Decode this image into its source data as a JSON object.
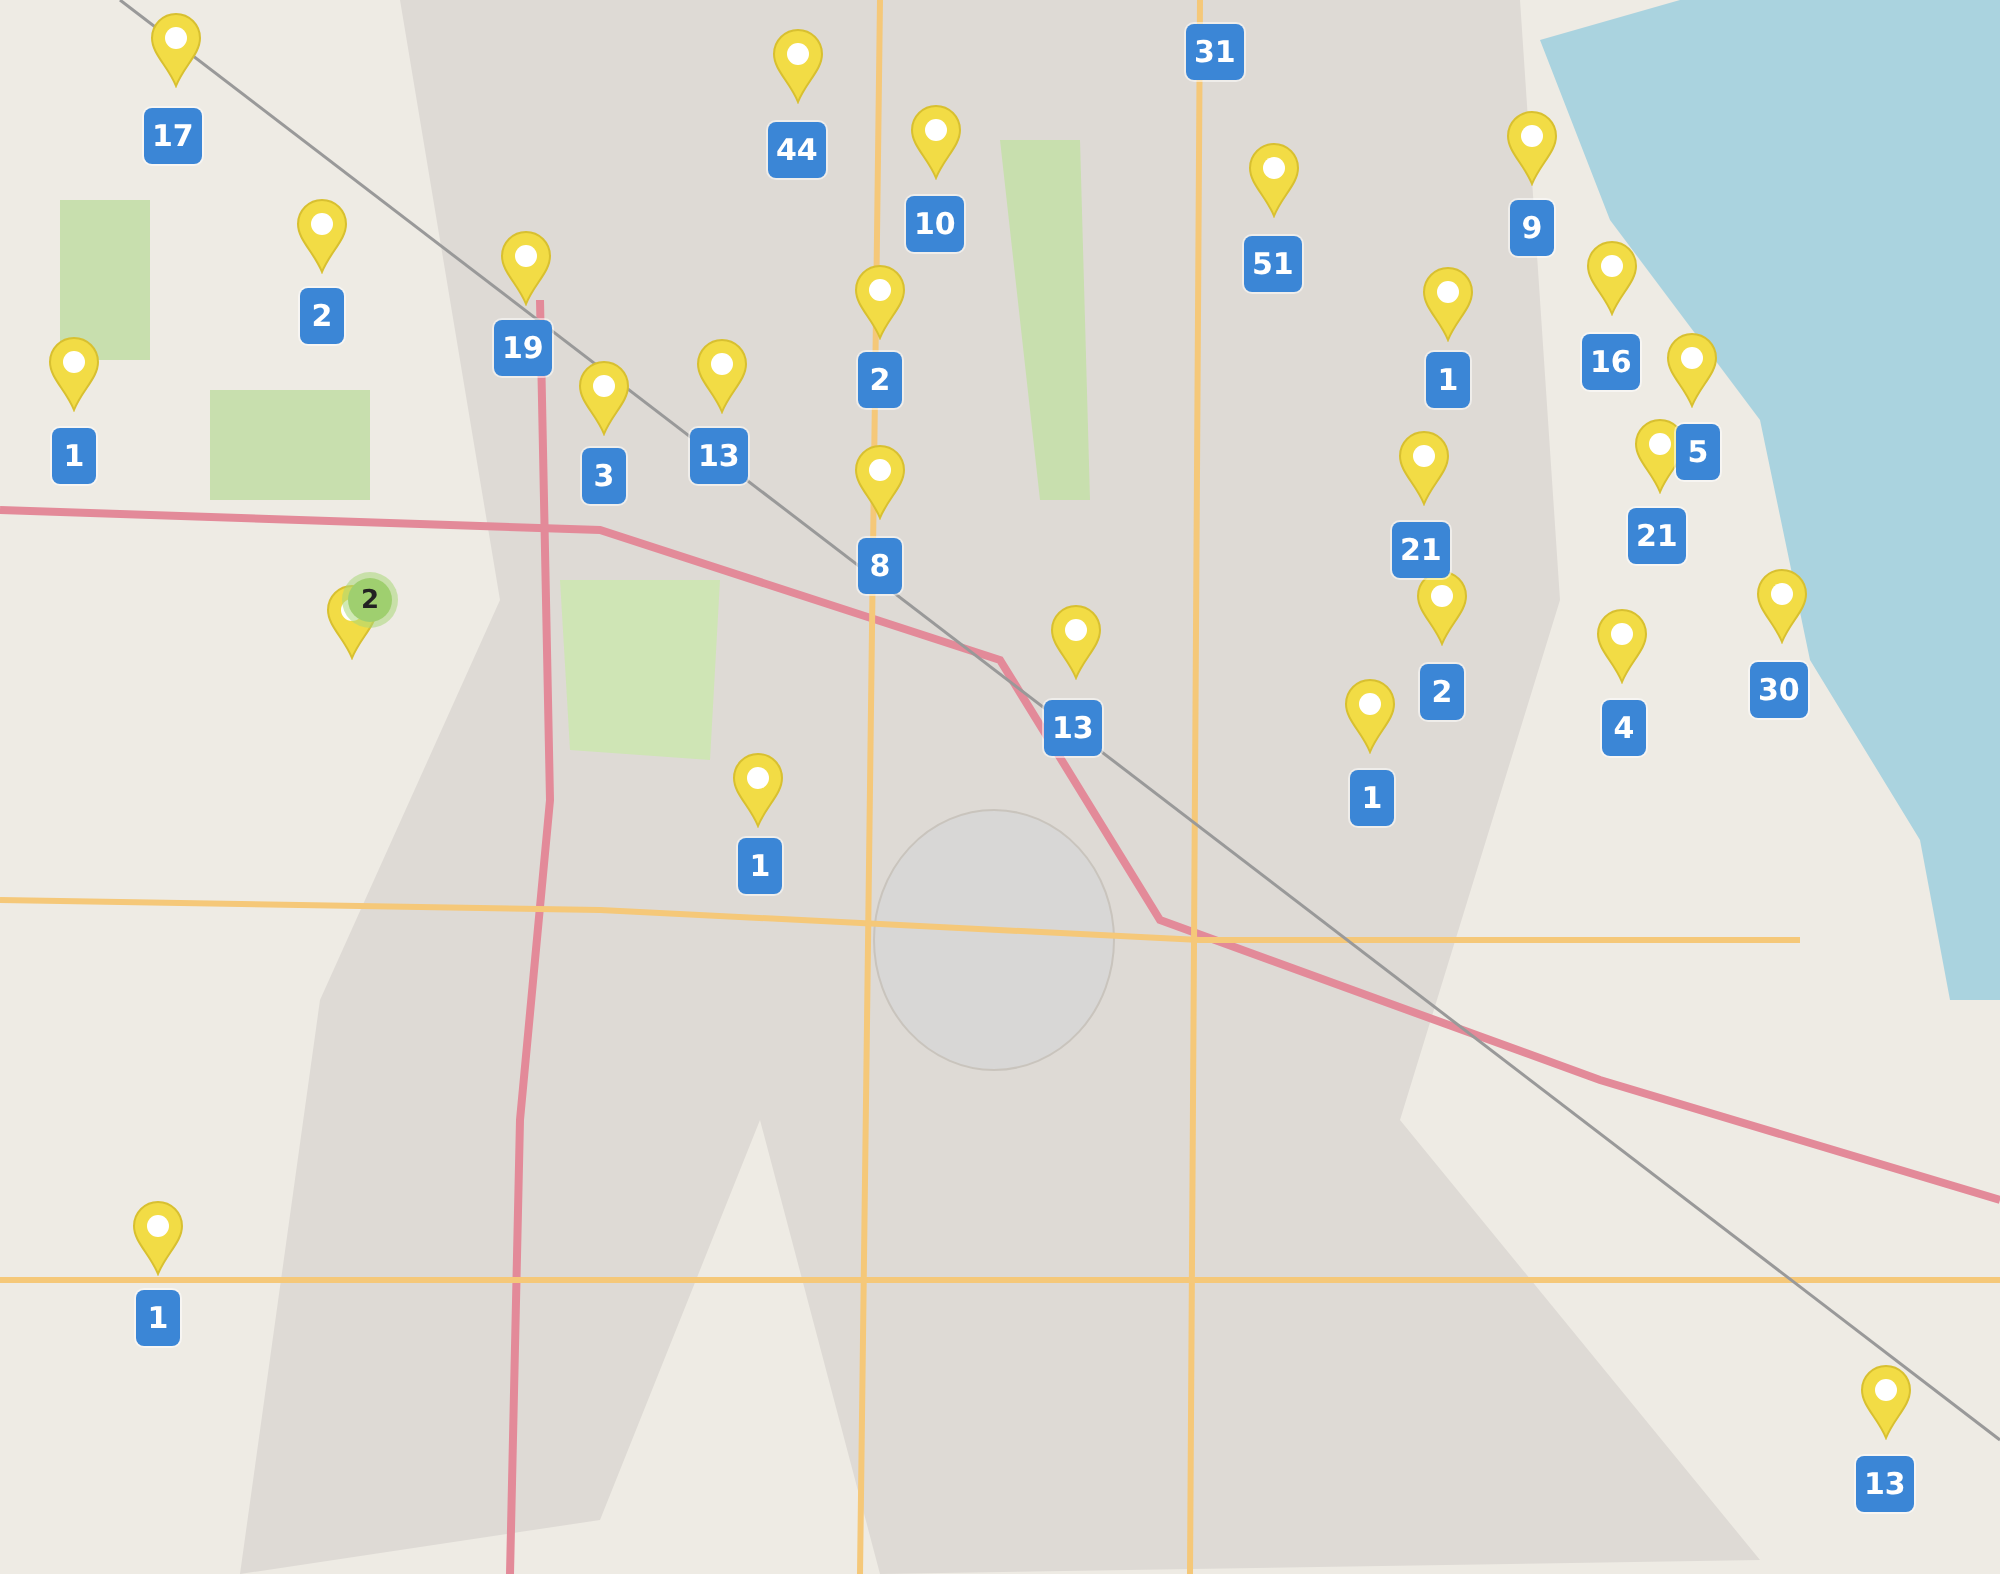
{
  "count_badges": [
    {
      "count": "17"
    },
    {
      "count": "44"
    },
    {
      "count": "10"
    },
    {
      "count": "31"
    },
    {
      "count": "51"
    },
    {
      "count": "9"
    },
    {
      "count": "2"
    },
    {
      "count": "19"
    },
    {
      "count": "2"
    },
    {
      "count": "1"
    },
    {
      "count": "16"
    },
    {
      "count": "1"
    },
    {
      "count": "3"
    },
    {
      "count": "13"
    },
    {
      "count": "5"
    },
    {
      "count": "21"
    },
    {
      "count": "21"
    },
    {
      "count": "8"
    },
    {
      "count": "2"
    },
    {
      "count": "4"
    },
    {
      "count": "13"
    },
    {
      "count": "30"
    },
    {
      "count": "1"
    },
    {
      "count": "1"
    },
    {
      "count": "1"
    },
    {
      "count": "13"
    }
  ],
  "cluster": {
    "count": "2"
  }
}
